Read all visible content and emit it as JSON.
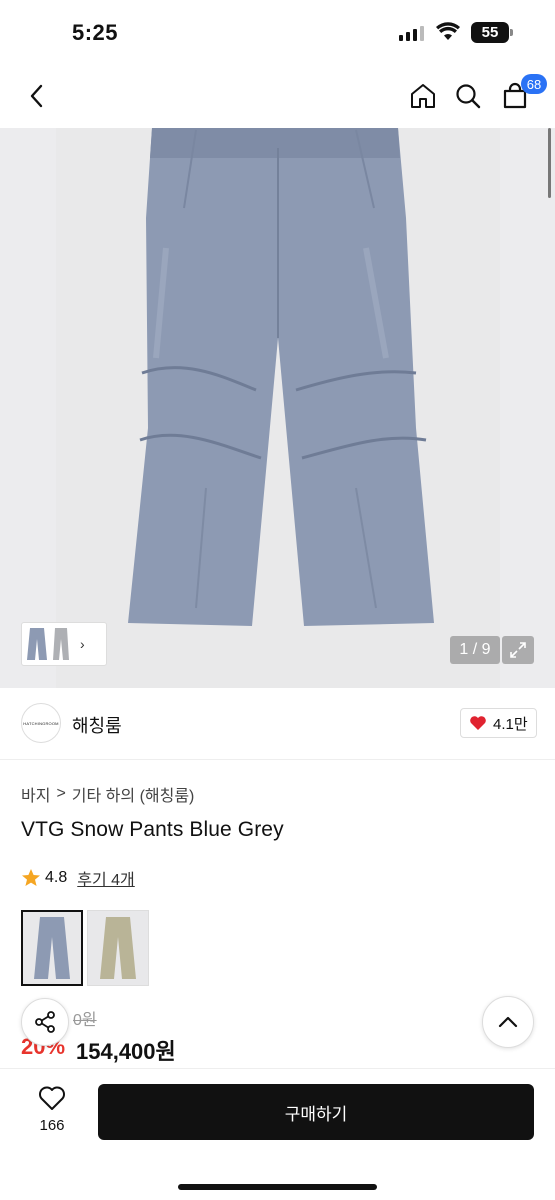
{
  "status": {
    "time": "5:25",
    "battery": "55"
  },
  "nav": {
    "cart_count": "68",
    "icons": [
      "back-icon",
      "home-icon",
      "search-icon",
      "bag-icon"
    ]
  },
  "gallery": {
    "counter": "1 / 9",
    "image_subject": "blue grey pleated snow pants"
  },
  "shop": {
    "logo_text": "HATCHINGROOM",
    "name": "해칭룸",
    "likes": "4.1만"
  },
  "breadcrumb": {
    "category": "바지",
    "separator": ">",
    "subcategory": "기타 하의 (해칭룸)"
  },
  "product": {
    "title": "VTG Snow Pants Blue Grey",
    "rating": "4.8",
    "reviews": "후기 4개",
    "colors": [
      {
        "swatch": "#8d9ab3",
        "selected": true
      },
      {
        "swatch": "#b9b497",
        "selected": false
      }
    ]
  },
  "price": {
    "original": "0원",
    "discount": "20%",
    "final": "154,400원"
  },
  "bottom": {
    "wish_count": "166",
    "buy_label": "구매하기"
  },
  "colors": {
    "accent_blue": "#2a72f5",
    "discount_red": "#e8342d",
    "heart_red": "#e02330",
    "star_orange": "#f5a623",
    "pants_blue": "#8d9ab3",
    "pants_beige": "#b9b497"
  }
}
